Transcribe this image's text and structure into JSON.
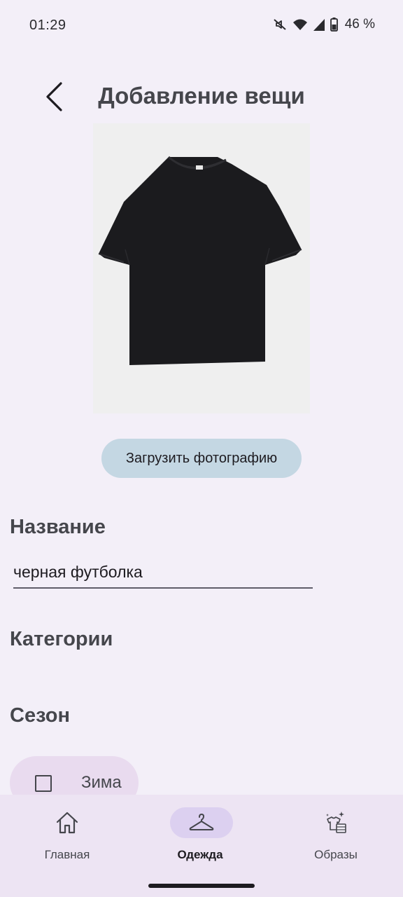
{
  "status_bar": {
    "time": "01:29",
    "battery": "46 %",
    "icons": [
      "mute-icon",
      "wifi-icon",
      "signal-icon",
      "battery-icon"
    ]
  },
  "header": {
    "title": "Добавление вещи",
    "back_icon": "chevron-left-icon"
  },
  "photo": {
    "subject": "black-tshirt-image",
    "background": "#efefef"
  },
  "upload": {
    "label": "Загрузить фотографию"
  },
  "name_section": {
    "heading": "Название",
    "value": "черная футболка"
  },
  "categories_section": {
    "heading": "Категории"
  },
  "season_section": {
    "heading": "Сезон",
    "option_label": "Зима",
    "checked": false
  },
  "bottom_nav": {
    "items": [
      {
        "label": "Главная",
        "icon": "home-icon",
        "active": false
      },
      {
        "label": "Одежда",
        "icon": "hanger-icon",
        "active": true
      },
      {
        "label": "Образы",
        "icon": "outfits-icon",
        "active": false
      }
    ]
  },
  "colors": {
    "background": "#f3eff8",
    "upload_button": "#c4d7e3",
    "chip": "#e9dbef",
    "nav_background": "#ede4f3",
    "nav_active_indicator": "#dcd0f0"
  }
}
